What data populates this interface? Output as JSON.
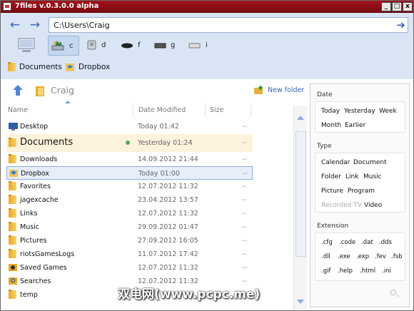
{
  "window": {
    "title": "7files v.0.3.0.0 alpha",
    "min": "_",
    "max": "□",
    "close": "x"
  },
  "nav": {
    "back": "←",
    "forward": "→"
  },
  "address": {
    "path": "C:\\Users\\Craig",
    "go": "➜"
  },
  "drives": [
    {
      "label": "",
      "icon": "computer-icon"
    },
    {
      "label": "c",
      "icon": "drive-c-icon"
    },
    {
      "label": "d",
      "icon": "drive-d-icon"
    },
    {
      "label": "f",
      "icon": "drive-f-icon"
    },
    {
      "label": "g",
      "icon": "drive-g-icon"
    },
    {
      "label": "i",
      "icon": "drive-i-icon"
    }
  ],
  "favorites": [
    {
      "label": "Documents",
      "icon": "folder-icon"
    },
    {
      "label": "Dropbox",
      "icon": "dropbox-folder-icon"
    }
  ],
  "current_folder": "Craig",
  "new_folder": "New folder",
  "columns": {
    "name": "Name",
    "date": "Date Modified",
    "size": "Size"
  },
  "files": [
    {
      "name": "Desktop",
      "date": "Today 01:42",
      "size": "--"
    },
    {
      "name": "Documents",
      "date": "Yesterday 01:24",
      "size": "--"
    },
    {
      "name": "Downloads",
      "date": "14.09.2012 21:44",
      "size": "--"
    },
    {
      "name": "Dropbox",
      "date": "Today 01:00",
      "size": "--"
    },
    {
      "name": "Favorites",
      "date": "12.07.2012 11:32",
      "size": "--"
    },
    {
      "name": "jagexcache",
      "date": "23.04.2012 13:57",
      "size": "--"
    },
    {
      "name": "Links",
      "date": "12.07.2012 11:32",
      "size": "--"
    },
    {
      "name": "Music",
      "date": "29.09.2012 01:47",
      "size": "--"
    },
    {
      "name": "Pictures",
      "date": "27.09.2012 16:05",
      "size": "--"
    },
    {
      "name": "riotsGamesLogs",
      "date": "11.07.2012 17:42",
      "size": "--"
    },
    {
      "name": "Saved Games",
      "date": "12.07.2012 11:32",
      "size": "--"
    },
    {
      "name": "Searches",
      "date": "12.07.2012 11:32",
      "size": "--"
    },
    {
      "name": "temp",
      "date": "",
      "size": "--"
    }
  ],
  "filters": {
    "date": {
      "title": "Date",
      "items": [
        "Today",
        "Yesterday",
        "Week",
        "Month",
        "Earlier"
      ]
    },
    "type": {
      "title": "Type",
      "items": [
        "Calendar",
        "Document",
        "Folder",
        "Link",
        "Music",
        "Picture",
        "Program",
        "Recorded TV",
        "Video"
      ]
    },
    "extension": {
      "title": "Extension",
      "items": [
        ".cfg",
        ".code",
        ".dat",
        ".dds",
        ".dll",
        ".exe",
        ".exp",
        ".fev",
        ".fsb",
        ".gif",
        ".help",
        ".html",
        ".ini"
      ]
    }
  },
  "watermark": "双电网(www.pcpc.me)"
}
